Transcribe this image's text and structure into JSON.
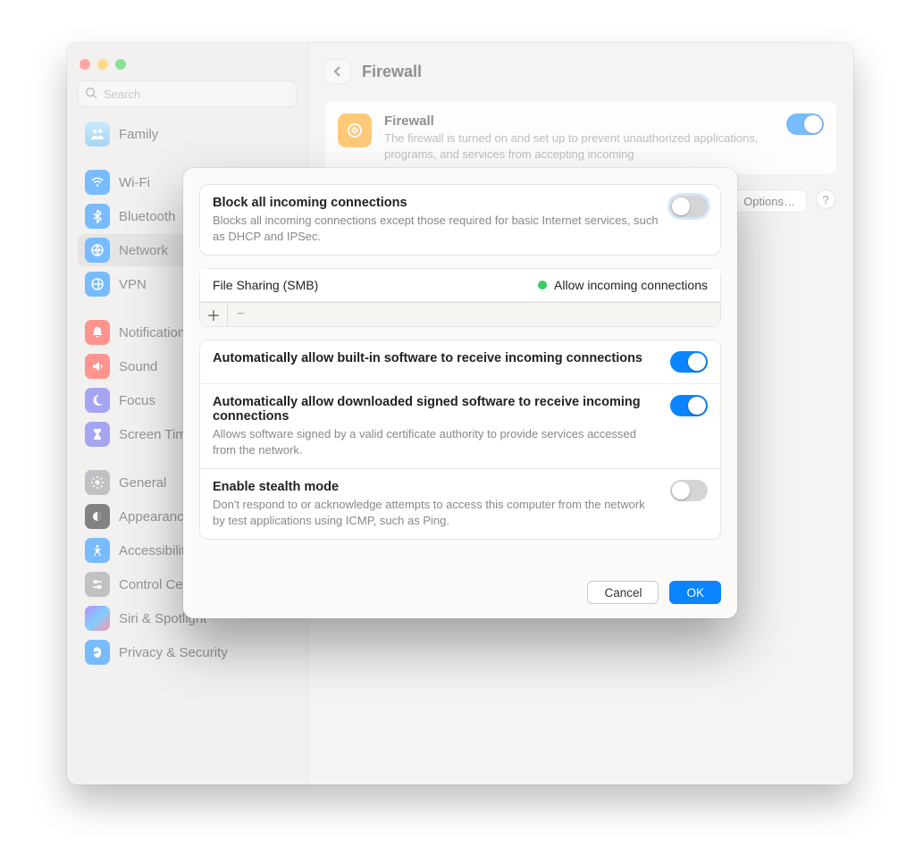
{
  "search": {
    "placeholder": "Search"
  },
  "sidebar": {
    "items": [
      {
        "label": "Family"
      },
      {
        "label": "Wi-Fi"
      },
      {
        "label": "Bluetooth"
      },
      {
        "label": "Network"
      },
      {
        "label": "VPN"
      },
      {
        "label": "Notifications"
      },
      {
        "label": "Sound"
      },
      {
        "label": "Focus"
      },
      {
        "label": "Screen Time"
      },
      {
        "label": "General"
      },
      {
        "label": "Appearance"
      },
      {
        "label": "Accessibility"
      },
      {
        "label": "Control Center"
      },
      {
        "label": "Siri & Spotlight"
      },
      {
        "label": "Privacy & Security"
      }
    ]
  },
  "header": {
    "title": "Firewall"
  },
  "firewall_card": {
    "title": "Firewall",
    "desc": "The firewall is turned on and set up to prevent unauthorized applications, programs, and services from accepting incoming",
    "enabled": true
  },
  "options_btn": {
    "label": "Options…"
  },
  "modal": {
    "block_all": {
      "title": "Block all incoming connections",
      "desc": "Blocks all incoming connections except those required for basic Internet services, such as DHCP and IPSec.",
      "value": false
    },
    "apps": {
      "rows": [
        {
          "name": "File Sharing (SMB)",
          "status": "Allow incoming connections"
        }
      ]
    },
    "auto_builtin": {
      "title": "Automatically allow built-in software to receive incoming connections",
      "value": true
    },
    "auto_signed": {
      "title": "Automatically allow downloaded signed software to receive incoming connections",
      "desc": "Allows software signed by a valid certificate authority to provide services accessed from the network.",
      "value": true
    },
    "stealth": {
      "title": "Enable stealth mode",
      "desc": "Don't respond to or acknowledge attempts to access this computer from the network by test applications using ICMP, such as Ping.",
      "value": false
    },
    "cancel": "Cancel",
    "ok": "OK"
  }
}
